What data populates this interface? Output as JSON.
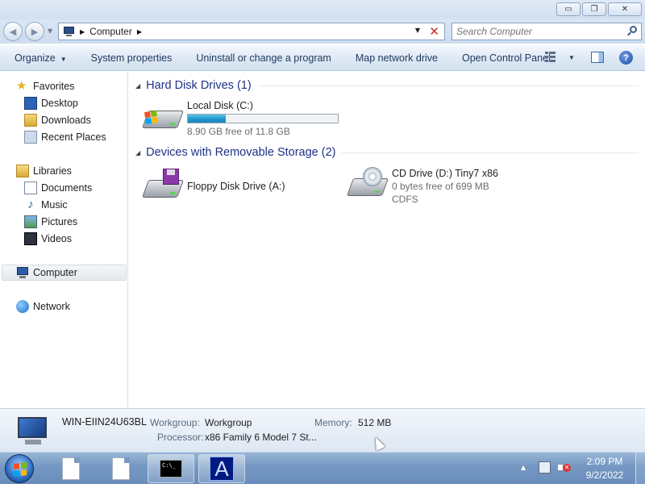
{
  "window": {
    "minimize_glyph": "▭",
    "restore_glyph": "❐",
    "close_glyph": "✕"
  },
  "address": {
    "location": "Computer",
    "search_placeholder": "Search Computer"
  },
  "toolbar": {
    "organize": "Organize",
    "system_properties": "System properties",
    "uninstall": "Uninstall or change a program",
    "map_drive": "Map network drive",
    "control_panel": "Open Control Panel",
    "help": "?"
  },
  "sidebar": {
    "favorites": "Favorites",
    "desktop": "Desktop",
    "downloads": "Downloads",
    "recent_places": "Recent Places",
    "libraries": "Libraries",
    "documents": "Documents",
    "music": "Music",
    "pictures": "Pictures",
    "videos": "Videos",
    "computer": "Computer",
    "network": "Network"
  },
  "content": {
    "hdd_group": "Hard Disk Drives (1)",
    "removable_group": "Devices with Removable Storage (2)",
    "local_disk": {
      "name": "Local Disk (C:)",
      "free": "8.90 GB free of 11.8 GB",
      "used_fraction": 0.25
    },
    "floppy": {
      "name": "Floppy Disk Drive (A:)"
    },
    "cd": {
      "name": "CD Drive (D:) Tiny7 x86",
      "free": "0 bytes free of 699 MB",
      "fs": "CDFS"
    }
  },
  "details": {
    "computer_name": "WIN-EIIN24U63BL",
    "workgroup_label": "Workgroup:",
    "workgroup_value": "Workgroup",
    "memory_label": "Memory:",
    "memory_value": "512 MB",
    "processor_label": "Processor:",
    "processor_value": "x86 Family 6 Model 7 St..."
  },
  "taskbar": {
    "cmd_text": "C:\\_",
    "app_letter": "A",
    "time": "2:09 PM",
    "date": "9/2/2022"
  }
}
